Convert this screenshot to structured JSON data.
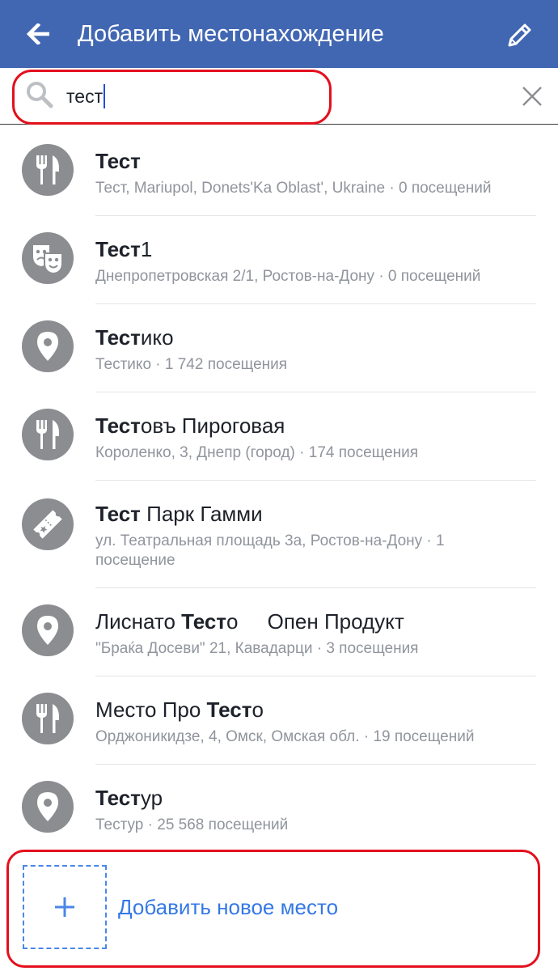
{
  "header": {
    "title": "Добавить местонахождение",
    "back_icon": "arrow-left-icon",
    "edit_icon": "pencil-icon",
    "background": "#4267b2"
  },
  "search": {
    "value": "тест",
    "icon": "search-icon",
    "clear_icon": "close-icon",
    "highlight_color": "#e3101e"
  },
  "results": [
    {
      "icon": "restaurant-icon",
      "name_bold": "Тест",
      "name_rest": "",
      "name_prefix": "",
      "subtitle": "Тест, Mariupol, Donets'Ka Oblast', Ukraine · 0 посещений"
    },
    {
      "icon": "theater-masks-icon",
      "name_bold": "Тест",
      "name_rest": "1",
      "name_prefix": "",
      "subtitle": "Днепропетровская 2/1, Ростов-на-Дону · 0 посещений"
    },
    {
      "icon": "location-pin-icon",
      "name_bold": "Тест",
      "name_rest": "ико",
      "name_prefix": "",
      "subtitle": "Тестико · 1 742 посещения"
    },
    {
      "icon": "restaurant-icon",
      "name_bold": "Тест",
      "name_rest": "овъ Пироговая",
      "name_prefix": "",
      "subtitle": "Короленко, 3, Днепр (город) · 174 посещения"
    },
    {
      "icon": "ticket-icon",
      "name_bold": "Тест",
      "name_rest": " Парк Гамми",
      "name_prefix": "",
      "subtitle": "ул. Театральная площадь 3а, Ростов-на-Дону · 1 посещение"
    },
    {
      "icon": "location-pin-icon",
      "name_prefix": "Лиснато ",
      "name_bold": "Тест",
      "name_rest": "о     Опен Продукт",
      "subtitle": "\"Браќа Досеви\"  21, Кавадарци · 3 посещения"
    },
    {
      "icon": "restaurant-icon",
      "name_prefix": "Место Про ",
      "name_bold": "Тест",
      "name_rest": "о",
      "subtitle": "Орджоникидзе, 4, Омск, Омская обл. · 19 посещений"
    },
    {
      "icon": "location-pin-icon",
      "name_bold": "Тест",
      "name_rest": "ур",
      "name_prefix": "",
      "subtitle": "Тестур · 25 568 посещений"
    }
  ],
  "add_place": {
    "label": "Добавить новое место",
    "icon": "plus-icon",
    "accent": "#3578e5"
  }
}
